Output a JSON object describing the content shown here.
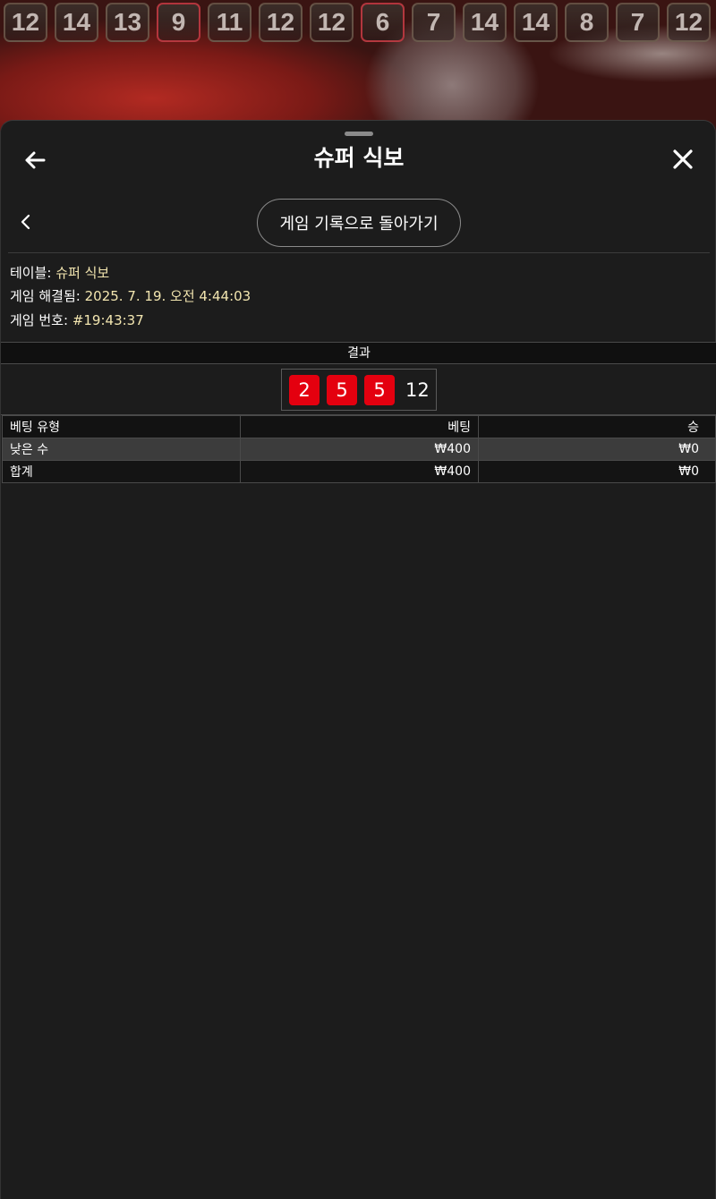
{
  "history": [
    "12",
    "14",
    "13",
    "9",
    "11",
    "12",
    "12",
    "6",
    "7",
    "14",
    "14",
    "8",
    "7",
    "12"
  ],
  "header": {
    "title": "슈퍼 식보",
    "back_icon": "arrow-left-icon",
    "close_icon": "close-icon"
  },
  "nav": {
    "back_chevron_icon": "chevron-left-icon",
    "history_button_label": "게임 기록으로 돌아가기"
  },
  "info": {
    "table_label": "테이블:",
    "table_value": "슈퍼 식보",
    "resolved_label": "게임 해결됨:",
    "resolved_value": "2025. 7. 19. 오전 4:44:03",
    "game_no_label": "게임 번호:",
    "game_no_value": "#19:43:37"
  },
  "result": {
    "header": "결과",
    "dice": [
      "2",
      "5",
      "5"
    ],
    "total": "12",
    "dice_color": "#e4000f"
  },
  "bets": {
    "columns": [
      "베팅 유형",
      "베팅",
      "승"
    ],
    "rows": [
      {
        "type": "낮은 수",
        "bet": "₩400",
        "win": "₩0"
      },
      {
        "type": "합계",
        "bet": "₩400",
        "win": "₩0"
      }
    ]
  },
  "colors": {
    "background": "#1b1b1b",
    "info_value": "#f3e6b0"
  }
}
